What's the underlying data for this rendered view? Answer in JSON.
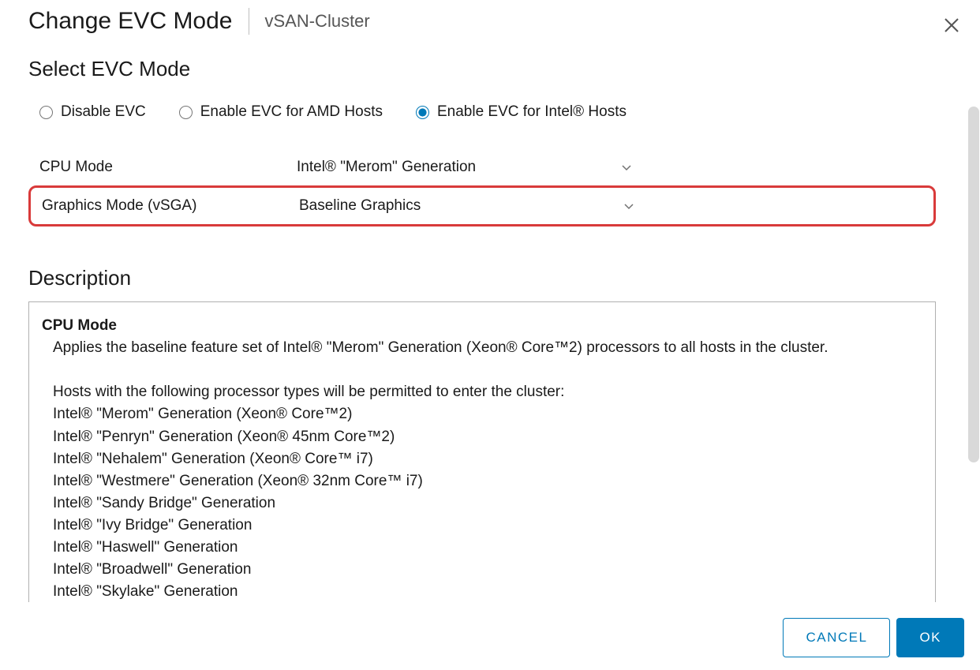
{
  "header": {
    "title": "Change EVC Mode",
    "subtitle": "vSAN-Cluster"
  },
  "section": {
    "heading": "Select EVC Mode"
  },
  "radios": {
    "disable": "Disable EVC",
    "amd": "Enable EVC for AMD Hosts",
    "intel": "Enable EVC for Intel® Hosts"
  },
  "selectors": {
    "cpu_label": "CPU Mode",
    "cpu_value": "Intel® \"Merom\" Generation",
    "gfx_label": "Graphics Mode (vSGA)",
    "gfx_value": "Baseline Graphics"
  },
  "description": {
    "heading": "Description",
    "subheading": "CPU Mode",
    "text": "Applies the baseline feature set of Intel® \"Merom\" Generation (Xeon® Core™2) processors to all hosts in the cluster.\n\nHosts with the following processor types will be permitted to enter the cluster:\nIntel® \"Merom\" Generation (Xeon® Core™2)\nIntel® \"Penryn\" Generation (Xeon® 45nm Core™2)\nIntel® \"Nehalem\" Generation (Xeon® Core™ i7)\nIntel® \"Westmere\" Generation (Xeon® 32nm Core™ i7)\nIntel® \"Sandy Bridge\" Generation\nIntel® \"Ivy Bridge\" Generation\nIntel® \"Haswell\" Generation\nIntel® \"Broadwell\" Generation\nIntel® \"Skylake\" Generation\nFuture Intel® processors"
  },
  "footer": {
    "cancel": "CANCEL",
    "ok": "OK"
  }
}
